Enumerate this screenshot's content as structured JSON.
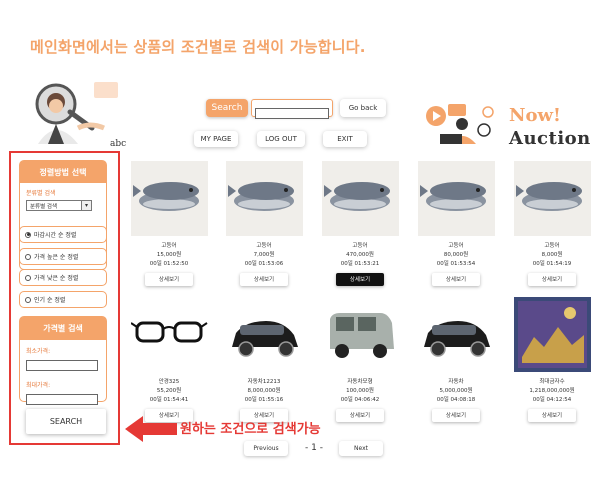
{
  "headline": "메인화면에서는 상품의 조건별로 검색이 가능합니다.",
  "illustration_text": "abc",
  "search": {
    "button_label": "Search",
    "placeholder": "",
    "value": ""
  },
  "nav": {
    "go_back": "Go back",
    "my_page": "MY PAGE",
    "logout": "LOG OUT",
    "exit": "EXIT"
  },
  "logo": {
    "line1": "Now!",
    "line2": "Auction"
  },
  "sidebar": {
    "sort_title": "정렬방법 선택",
    "category_label": "분류별 검색",
    "category_select": "분류별 검색",
    "sort_options": [
      {
        "label": "마감시간 순 정렬",
        "selected": true
      },
      {
        "label": "가격 높은 순 정렬",
        "selected": false
      },
      {
        "label": "가격 낮은 순 정렬",
        "selected": false
      },
      {
        "label": "인기 순 정렬",
        "selected": false
      }
    ],
    "price_title": "가격별 검색",
    "min_label": "최소가격:",
    "max_label": "최대가격:",
    "search_button": "SEARCH"
  },
  "products": [
    {
      "name": "고등어",
      "price": "15,000원",
      "time": "00일 01:52:50",
      "detail": "상세보기",
      "image": "fish-icon",
      "active": false
    },
    {
      "name": "고등어",
      "price": "7,000원",
      "time": "00일 01:53:06",
      "detail": "상세보기",
      "image": "fish-icon",
      "active": false
    },
    {
      "name": "고등어",
      "price": "470,000원",
      "time": "00일 01:53:21",
      "detail": "상세보기",
      "image": "fish-icon",
      "active": true
    },
    {
      "name": "고등어",
      "price": "80,000원",
      "time": "00일 01:53:54",
      "detail": "상세보기",
      "image": "fish-icon",
      "active": false
    },
    {
      "name": "고등어",
      "price": "8,000원",
      "time": "00일 01:54:19",
      "detail": "상세보기",
      "image": "fish-icon",
      "active": false
    },
    {
      "name": "안경325",
      "price": "55,200원",
      "time": "00일 01:54:41",
      "detail": "상세보기",
      "image": "glasses-icon",
      "active": false
    },
    {
      "name": "자동차12213",
      "price": "8,000,000원",
      "time": "00일 01:55:16",
      "detail": "상세보기",
      "image": "car-icon",
      "active": false
    },
    {
      "name": "자동차모형",
      "price": "100,000원",
      "time": "00일 04:06:42",
      "detail": "상세보기",
      "image": "van-icon",
      "active": false
    },
    {
      "name": "자동차",
      "price": "5,000,000원",
      "time": "00일 04:08:18",
      "detail": "상세보기",
      "image": "car-icon",
      "active": false
    },
    {
      "name": "최대금자수",
      "price": "1,218,000,000원",
      "time": "00일 04:12:54",
      "detail": "상세보기",
      "image": "poster-icon",
      "active": false
    }
  ],
  "annotation": "원하는 조건으로 검색가능",
  "pagination": {
    "previous": "Previous",
    "current": "- 1 -",
    "next": "Next"
  },
  "colors": {
    "accent": "#f4a46a",
    "highlight": "#e53935"
  }
}
